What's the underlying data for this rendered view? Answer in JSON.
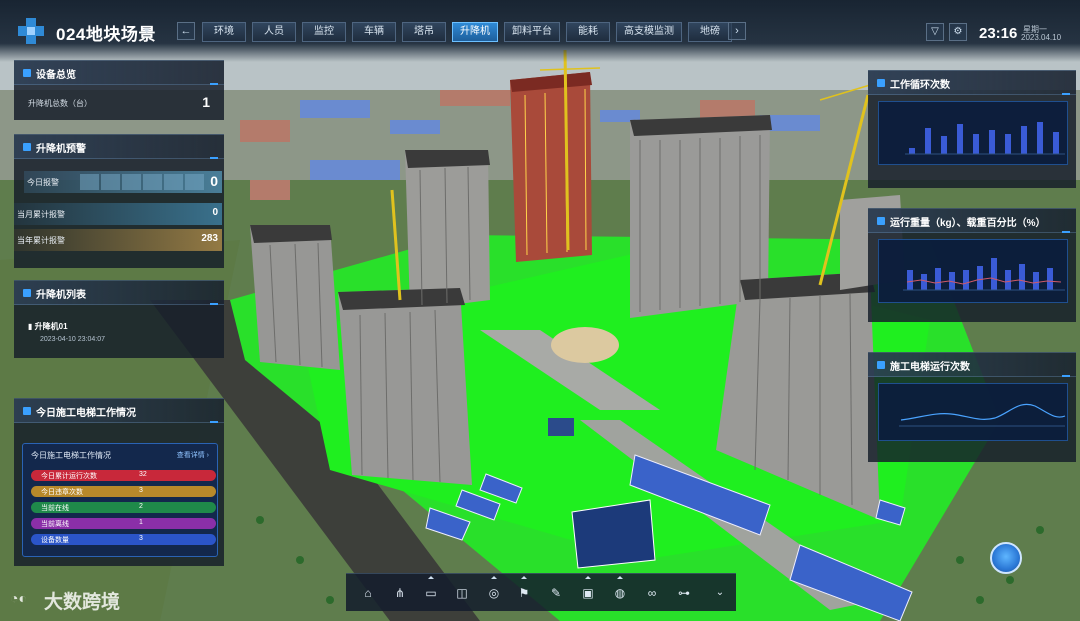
{
  "header": {
    "site_title": "024地块场景",
    "nav_prev": "←",
    "nav_next": "›",
    "tabs": [
      {
        "label": "环境"
      },
      {
        "label": "人员"
      },
      {
        "label": "监控"
      },
      {
        "label": "车辆"
      },
      {
        "label": "塔吊"
      },
      {
        "label": "升降机",
        "active": true
      },
      {
        "label": "卸料平台"
      },
      {
        "label": "能耗"
      },
      {
        "label": "高支模监测"
      },
      {
        "label": "地磅"
      }
    ],
    "clock": "23:16",
    "weekday": "星期一",
    "date": "2023.04.10",
    "accent_color": "#2f8ad6"
  },
  "overview": {
    "title": "设备总览",
    "total_label": "升降机总数（台）",
    "total_value": "1"
  },
  "alarms": {
    "title": "升降机预警",
    "today_label": "今日报警",
    "today_value": "0",
    "month_label": "当月累计报警",
    "month_value": "0",
    "year_label": "当年累计报警",
    "year_value": "283"
  },
  "hoist_list": {
    "title": "升降机列表",
    "items": [
      {
        "name": "升降机01",
        "time": "2023-04-10 23:04:07"
      }
    ]
  },
  "work_status": {
    "title": "今日施工电梯工作情况",
    "box_title": "今日施工电梯工作情况",
    "detail_link": "查看详情 ›",
    "rows": [
      {
        "label": "今日累计运行次数",
        "value": "32",
        "color": "#c8283a"
      },
      {
        "label": "今日违章次数",
        "value": "3",
        "color": "#b8892a"
      },
      {
        "label": "当前在线",
        "value": "2",
        "color": "#1f8a4a"
      },
      {
        "label": "当前离线",
        "value": "1",
        "color": "#8a2fa8"
      },
      {
        "label": "设备数量",
        "value": "3",
        "color": "#2b55c8"
      }
    ]
  },
  "right_panels": {
    "cycles_title": "工作循环次数",
    "weight_title": "运行重量（kg）、载重百分比（%）",
    "elevator_title": "施工电梯运行次数"
  },
  "toolbar": {
    "icons": [
      "home-icon",
      "network-icon",
      "panel-icon",
      "split-icon",
      "locate-icon",
      "flag-icon",
      "edit-icon",
      "layers-icon",
      "globe-icon",
      "link-icon",
      "settings-sliders-icon",
      "chevron-down-icon"
    ]
  },
  "watermark": "大数跨境"
}
